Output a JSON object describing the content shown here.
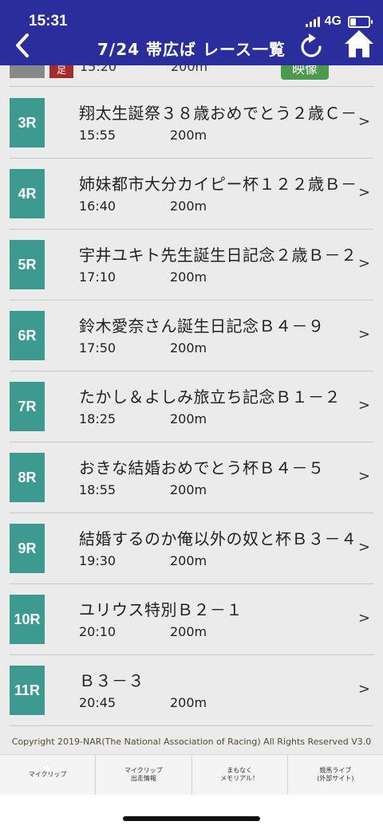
{
  "status_bar": {
    "time": "15:31",
    "network": "4G"
  },
  "header": {
    "title": "7/24 帯広ば レース一覧"
  },
  "partial_row": {
    "badge": "足",
    "time": "15:20",
    "distance": "200m",
    "video_label": "映像"
  },
  "races": [
    {
      "num": "3R",
      "name": "翔太生誕祭３８歳おめでとう２歳Ｃ－",
      "time": "15:55",
      "distance": "200m"
    },
    {
      "num": "4R",
      "name": "姉妹都市大分カイピー杯１２２歳Ｂ－",
      "time": "16:40",
      "distance": "200m"
    },
    {
      "num": "5R",
      "name": "宇井ユキト先生誕生日記念２歳Ｂ－２",
      "time": "17:10",
      "distance": "200m"
    },
    {
      "num": "6R",
      "name": "鈴木愛奈さん誕生日記念Ｂ４－９",
      "time": "17:50",
      "distance": "200m"
    },
    {
      "num": "7R",
      "name": "たかし＆よしみ旅立ち記念Ｂ１－２",
      "time": "18:25",
      "distance": "200m"
    },
    {
      "num": "8R",
      "name": "おきな結婚おめでとう杯Ｂ４－５",
      "time": "18:55",
      "distance": "200m"
    },
    {
      "num": "9R",
      "name": "結婚するのか俺以外の奴と杯Ｂ３－４",
      "time": "19:30",
      "distance": "200m"
    },
    {
      "num": "10R",
      "name": "ユリウス特別Ｂ２－１",
      "time": "20:10",
      "distance": "200m"
    },
    {
      "num": "11R",
      "name": "Ｂ３－３",
      "time": "20:45",
      "distance": "200m"
    }
  ],
  "arrow": ">",
  "copyright": "Copyright 2019-NAR(The National Association of Racing) All Rights Reserved V3.0",
  "tabs": [
    {
      "line1": "マイクリップ",
      "line2": ""
    },
    {
      "line1": "マイクリップ",
      "line2": "出走情報"
    },
    {
      "line1": "まもなく",
      "line2": "メモリアル！"
    },
    {
      "line1": "競馬ライブ",
      "line2": "(外部サイト)"
    }
  ],
  "colors": {
    "header": "#2a2e9c",
    "race_badge": "#3d9a91",
    "video_badge": "#4c9a4c"
  }
}
